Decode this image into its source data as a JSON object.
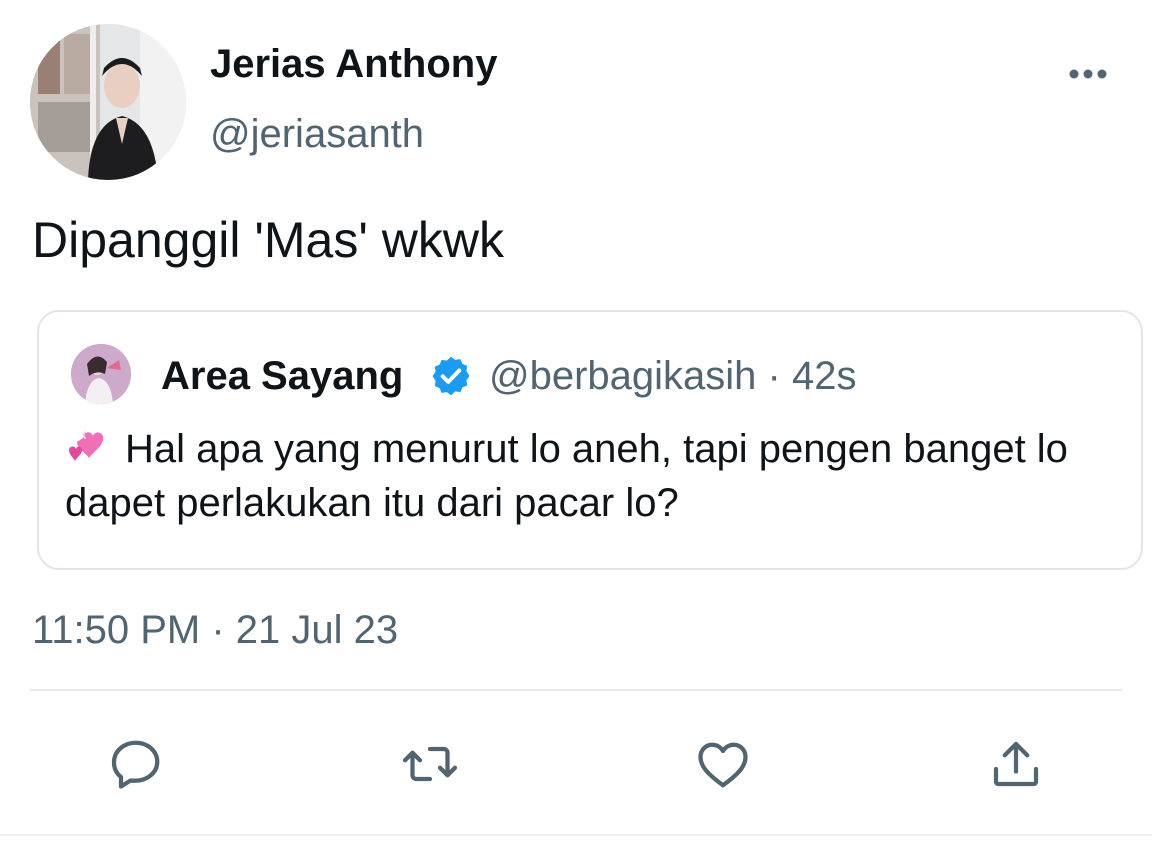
{
  "tweet": {
    "author": {
      "display_name": "Jerias Anthony",
      "handle": "@jeriasanth"
    },
    "text": "Dipanggil 'Mas' wkwk",
    "timestamp": "11:50 PM · 21 Jul 23"
  },
  "quoted_tweet": {
    "author": {
      "display_name": "Area Sayang",
      "verified": true
    },
    "meta": "@berbagikasih · 42s",
    "emoji": "revolving-hearts",
    "text": "Hal apa yang menurut lo aneh, tapi pengen banget lo dapet perlakukan itu dari pacar lo?"
  },
  "icons": {
    "more": "more-horizontal-icon",
    "verified": "verified-badge-icon",
    "reply": "reply-icon",
    "retweet": "retweet-icon",
    "like": "heart-icon",
    "share": "share-icon"
  },
  "colors": {
    "text_primary": "#0f1419",
    "text_secondary": "#536471",
    "verified_blue": "#1d9bf0",
    "border": "#dfe5e9"
  }
}
